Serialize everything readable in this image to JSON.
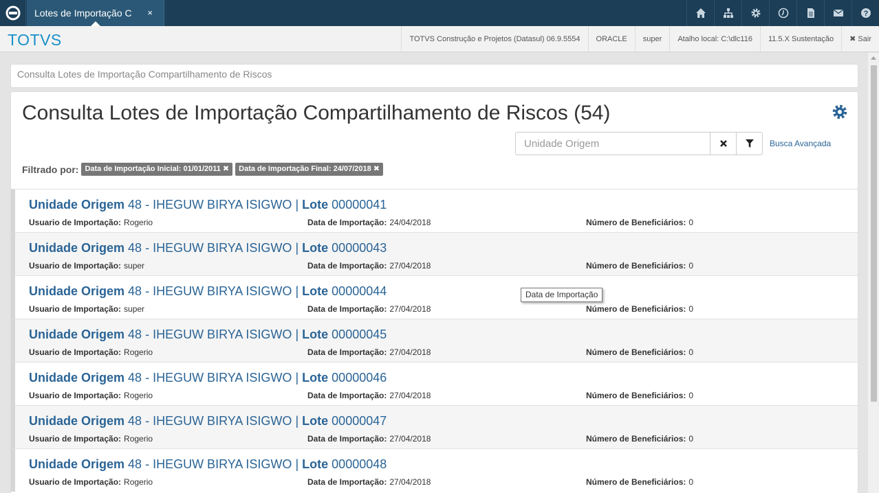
{
  "topbar": {
    "tab_label": "Lotes de Importação C",
    "tab_close": "×",
    "icons": [
      "home-icon",
      "sitemap-icon",
      "settings-icon",
      "clock-icon",
      "document-icon",
      "mail-icon",
      "help-icon"
    ],
    "bg_color": "#1c3e57"
  },
  "infobar": {
    "brand": "TOTVS",
    "items": [
      "TOTVS Construção e Projetos (Datasul) 06.9.5554",
      "ORACLE",
      "super",
      "Atalho local: C:\\dlc116",
      "11.5.X Sustentação"
    ],
    "sair": "✖ Sair"
  },
  "breadcrumb": "Consulta Lotes de Importação Compartilhamento de Riscos",
  "page": {
    "title": "Consulta Lotes de Importação Compartilhamento de Riscos (54)",
    "search_placeholder": "Unidade Origem",
    "busca_avancada": "Busca Avançada",
    "filtered_label": "Filtrado por:",
    "filters": [
      "Data de Importação Inicial: 01/01/2011",
      "Data de Importação Final: 24/07/2018"
    ],
    "filter_remove": "✖"
  },
  "labels": {
    "unidade": "Unidade Origem",
    "lote": "Lote",
    "separator": "|",
    "usuario": "Usuario de Importação:",
    "data": "Data de Importação:",
    "numero": "Número de Beneficiários:"
  },
  "rows": [
    {
      "unidade": "48 - IHEGUW BIRYA ISIGWO",
      "lote": "00000041",
      "usuario": "Rogerio",
      "data": "24/04/2018",
      "numero": "0"
    },
    {
      "unidade": "48 - IHEGUW BIRYA ISIGWO",
      "lote": "00000043",
      "usuario": "super",
      "data": "27/04/2018",
      "numero": "0"
    },
    {
      "unidade": "48 - IHEGUW BIRYA ISIGWO",
      "lote": "00000044",
      "usuario": "super",
      "data": "27/04/2018",
      "numero": "0"
    },
    {
      "unidade": "48 - IHEGUW BIRYA ISIGWO",
      "lote": "00000045",
      "usuario": "Rogerio",
      "data": "27/04/2018",
      "numero": "0"
    },
    {
      "unidade": "48 - IHEGUW BIRYA ISIGWO",
      "lote": "00000046",
      "usuario": "Rogerio",
      "data": "27/04/2018",
      "numero": "0"
    },
    {
      "unidade": "48 - IHEGUW BIRYA ISIGWO",
      "lote": "00000047",
      "usuario": "Rogerio",
      "data": "27/04/2018",
      "numero": "0"
    },
    {
      "unidade": "48 - IHEGUW BIRYA ISIGWO",
      "lote": "00000048",
      "usuario": "Rogerio",
      "data": "27/04/2018",
      "numero": "0"
    }
  ],
  "tooltip": "Data de Importação",
  "colors": {
    "accent": "#2a6496",
    "brand": "#1a91c9"
  }
}
